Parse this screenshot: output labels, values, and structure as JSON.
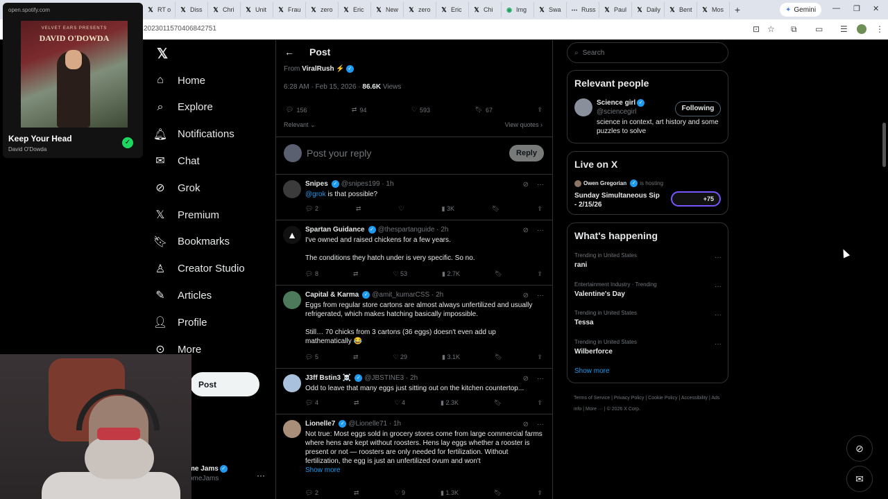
{
  "browser": {
    "tabs": [
      {
        "label": "RT o",
        "icon": "x-logo-icon"
      },
      {
        "label": "Diss",
        "icon": "x-logo-icon"
      },
      {
        "label": "Chri",
        "icon": "x-logo-icon"
      },
      {
        "label": "Unit",
        "icon": "x-logo-icon"
      },
      {
        "label": "Frau",
        "icon": "x-logo-icon"
      },
      {
        "label": "zero",
        "icon": "x-logo-icon"
      },
      {
        "label": "Eric",
        "icon": "x-logo-icon"
      },
      {
        "label": "New",
        "icon": "x-logo-icon"
      },
      {
        "label": "zero",
        "icon": "x-logo-icon"
      },
      {
        "label": "Eric",
        "icon": "x-logo-icon"
      },
      {
        "label": "Chi",
        "icon": "x-logo-icon"
      },
      {
        "label": "Img",
        "icon": "image-app-icon"
      },
      {
        "label": "Swa",
        "icon": "x-logo-icon"
      },
      {
        "label": "Russ",
        "icon": "dots-icon"
      },
      {
        "label": "Paul",
        "icon": "x-logo-icon"
      },
      {
        "label": "Daily",
        "icon": "x-logo-icon"
      },
      {
        "label": "Bent",
        "icon": "x-logo-icon"
      },
      {
        "label": "Mos",
        "icon": "x-logo-icon"
      }
    ],
    "new_tab": "+",
    "gemini_label": "Gemini",
    "url": "20230115704068427 51",
    "url_text": "2023011570406842751"
  },
  "spotify": {
    "url": "open.spotify.com",
    "album_top": "VELVET EARS PRESENTS",
    "album_artist": "DAVID O'DOWDA",
    "title": "Keep Your Head",
    "artist": "David O'Dowda"
  },
  "nav": {
    "items": [
      {
        "label": "Home",
        "icon": "home-icon"
      },
      {
        "label": "Explore",
        "icon": "search-icon"
      },
      {
        "label": "Notifications",
        "icon": "bell-icon"
      },
      {
        "label": "Chat",
        "icon": "mail-icon"
      },
      {
        "label": "Grok",
        "icon": "grok-icon"
      },
      {
        "label": "Premium",
        "icon": "x-logo-icon"
      },
      {
        "label": "Bookmarks",
        "icon": "bookmark-icon"
      },
      {
        "label": "Creator Studio",
        "icon": "creator-icon"
      },
      {
        "label": "Articles",
        "icon": "articles-icon"
      },
      {
        "label": "Profile",
        "icon": "profile-icon"
      },
      {
        "label": "More",
        "icon": "more-icon"
      }
    ],
    "post_button": "Post",
    "user_name": "me Jams",
    "user_handle": "omeJams"
  },
  "post": {
    "header": "Post",
    "from_label": "From",
    "from_name": "ViralRush",
    "from_emoji": "⚡",
    "time": "6:28 AM · Feb 15, 2026 ·",
    "views_count": "86.6K",
    "views_label": "Views",
    "replies": "156",
    "reposts": "94",
    "likes": "593",
    "bookmarks": "67",
    "sort_label": "Relevant",
    "view_quotes": "View quotes",
    "reply_placeholder": "Post your reply",
    "reply_button": "Reply"
  },
  "replies": [
    {
      "name": "Snipes",
      "handle": "@snipes199 · 1h",
      "mention": "@grok",
      "text": " is that possible?",
      "replies": "2",
      "reposts": "",
      "likes": "",
      "views": "3K"
    },
    {
      "name": "Spartan Guidance",
      "handle": "@thespartanguide · 2h",
      "text": "I've owned and raised chickens for a few years.\n\nThe conditions they hatch under is very specific. So no.",
      "replies": "8",
      "reposts": "",
      "likes": "53",
      "views": "2.7K"
    },
    {
      "name": "Capital & Karma",
      "handle": "@amit_kumarCSS · 2h",
      "text": "Eggs from regular store cartons are almost always unfertilized and usually refrigerated, which makes hatching basically impossible.\n\nStill… 70 chicks from 3 cartons (36 eggs) doesn't even add up mathematically 😂",
      "replies": "5",
      "reposts": "",
      "likes": "29",
      "views": "3.1K"
    },
    {
      "name": "J3ff Bstin3 ☠️",
      "handle": "@JBSTINE3 · 2h",
      "text": "Odd to leave that many eggs just sitting out on the kitchen countertop...",
      "replies": "4",
      "reposts": "",
      "likes": "4",
      "views": "2.3K"
    },
    {
      "name": "Lionelle7",
      "handle": "@Lionelle71 · 1h",
      "text": "Not true: Most eggs sold in grocery stores come from large commercial farms where hens are kept without roosters. Hens lay eggs whether a rooster is present or not — roosters are only needed for fertilization. Without fertilization, the egg is just an unfertilized ovum and won't",
      "show_more": "Show more",
      "replies": "2",
      "reposts": "",
      "likes": "9",
      "views": "1.3K"
    }
  ],
  "right": {
    "search_placeholder": "Search",
    "relevant_title": "Relevant people",
    "person_name": "Science girl",
    "person_handle": "@sciencegirl",
    "person_bio": "science in context, art history and some puzzles to solve",
    "follow_label": "Following",
    "live_title": "Live on X",
    "live_host": "Owen Gregorian",
    "live_hosting": "is hosting",
    "live_event": "Sunday Simultaneous Sip - 2/15/26",
    "live_count": "+75",
    "happening_title": "What's happening",
    "trends": [
      {
        "context": "Trending in United States",
        "topic": "rani"
      },
      {
        "context": "Entertainment Industry · Trending",
        "topic": "Valentine's Day"
      },
      {
        "context": "Trending in United States",
        "topic": "Tessa"
      },
      {
        "context": "Trending in United States",
        "topic": "Wilberforce"
      }
    ],
    "show_more": "Show more",
    "footer": [
      "Terms of Service",
      "Privacy Policy",
      "Cookie Policy",
      "Accessibility",
      "Ads info",
      "More ···",
      "© 2026 X Corp."
    ]
  },
  "colors": {
    "accent": "#1d9bf0",
    "background": "#000000",
    "border": "#2f3336",
    "muted": "#71767b",
    "spotify_green": "#1ed760"
  }
}
